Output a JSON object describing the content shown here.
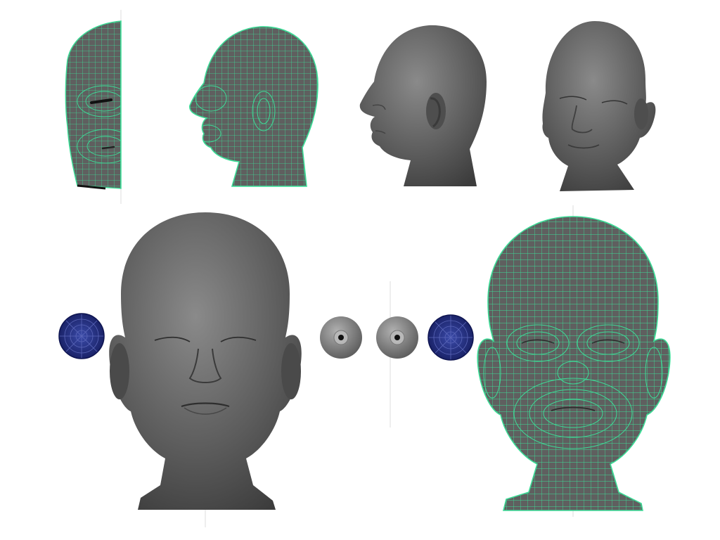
{
  "sheet": {
    "background": "#ffffff",
    "model_color": "#5f5f5f",
    "wireframe_color": "#3ddc97",
    "eyeball_wire_color": "#1f2a7a",
    "eyeball_wire_line": "#5a66b8",
    "eyeball_shaded_color": "#8a8a8a",
    "views": [
      {
        "name": "half-face-wireframe-front",
        "style": "wireframe"
      },
      {
        "name": "head-wireframe-side",
        "style": "wireframe"
      },
      {
        "name": "head-shaded-side",
        "style": "shaded"
      },
      {
        "name": "head-shaded-three-quarter",
        "style": "shaded"
      },
      {
        "name": "head-shaded-front",
        "style": "shaded"
      },
      {
        "name": "head-wireframe-front",
        "style": "wireframe"
      }
    ],
    "eyeballs": [
      {
        "name": "eyeball-wire-left",
        "style": "wireframe"
      },
      {
        "name": "eyeball-shaded-1",
        "style": "shaded"
      },
      {
        "name": "eyeball-shaded-2",
        "style": "shaded"
      },
      {
        "name": "eyeball-wire-right",
        "style": "wireframe"
      }
    ]
  }
}
